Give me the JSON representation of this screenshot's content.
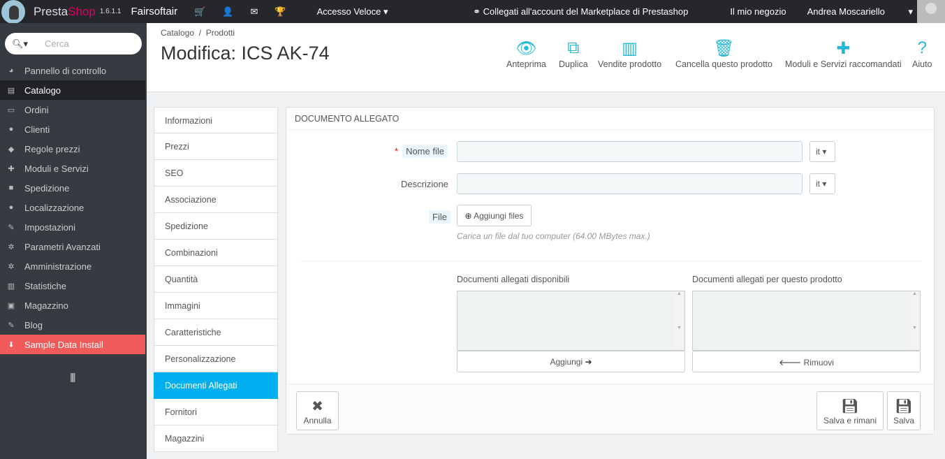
{
  "topbar": {
    "brand_a": "Presta",
    "brand_b": "Shop",
    "version": "1.6.1.1",
    "shop_name": "Fairsoftair",
    "quick_access": "Accesso Veloce",
    "marketplace": "Collegati all'account del Marketplace di Prestashop",
    "my_shop": "Il mio negozio",
    "user": "Andrea Moscariello"
  },
  "sidebar": {
    "search_placeholder": "Cerca",
    "items": [
      {
        "label": "Pannello di controllo",
        "icon": "dashboard-icon",
        "glyph": "◕"
      },
      {
        "label": "Catalogo",
        "icon": "book-icon",
        "glyph": "▤",
        "active": true
      },
      {
        "label": "Ordini",
        "icon": "credit-card-icon",
        "glyph": "▭"
      },
      {
        "label": "Clienti",
        "icon": "users-icon",
        "glyph": "●"
      },
      {
        "label": "Regole prezzi",
        "icon": "tags-icon",
        "glyph": "◆"
      },
      {
        "label": "Moduli e Servizi",
        "icon": "puzzle-icon",
        "glyph": "✚"
      },
      {
        "label": "Spedizione",
        "icon": "truck-icon",
        "glyph": "■"
      },
      {
        "label": "Localizzazione",
        "icon": "globe-icon",
        "glyph": "●"
      },
      {
        "label": "Impostazioni",
        "icon": "wrench-icon",
        "glyph": "✎"
      },
      {
        "label": "Parametri Avanzati",
        "icon": "cogs-icon",
        "glyph": "✲"
      },
      {
        "label": "Amministrazione",
        "icon": "cog-icon",
        "glyph": "✲"
      },
      {
        "label": "Statistiche",
        "icon": "bar-chart-icon",
        "glyph": "▥"
      },
      {
        "label": "Magazzino",
        "icon": "archive-icon",
        "glyph": "▣"
      },
      {
        "label": "Blog",
        "icon": "edit-icon",
        "glyph": "✎"
      },
      {
        "label": "Sample Data Install",
        "icon": "download-icon",
        "glyph": "⬇",
        "red": true
      }
    ]
  },
  "header": {
    "breadcrumb": [
      "Catalogo",
      "Prodotti"
    ],
    "title": "Modifica: ICS AK-74",
    "toolbar": [
      {
        "label": "Anteprima",
        "icon": "eye-icon",
        "glyph": "👁"
      },
      {
        "label": "Duplica",
        "icon": "copy-icon",
        "glyph": "⧉"
      },
      {
        "label": "Vendite prodotto",
        "icon": "bar-chart-icon",
        "glyph": "▥"
      },
      {
        "label": "Cancella questo prodotto",
        "icon": "trash-icon",
        "glyph": "🗑"
      },
      {
        "label": "Moduli e Servizi raccomandati",
        "icon": "puzzle-icon",
        "glyph": "✚"
      },
      {
        "label": "Aiuto",
        "icon": "question-icon",
        "glyph": "?"
      }
    ]
  },
  "tabs": [
    "Informazioni",
    "Prezzi",
    "SEO",
    "Associazione",
    "Spedizione",
    "Combinazioni",
    "Quantità",
    "Immagini",
    "Caratteristiche",
    "Personalizzazione",
    "Documenti Allegati",
    "Fornitori",
    "Magazzini"
  ],
  "active_tab": "Documenti Allegati",
  "panel": {
    "title": "DOCUMENTO ALLEGATO",
    "name_label": "Nome file",
    "name_value": "",
    "desc_label": "Descrizione",
    "desc_value": "",
    "lang": "it",
    "file_label": "File",
    "add_files": "Aggiungi files",
    "hint": "Carica un file dal tuo computer (64.00 MBytes max.)",
    "available_label": "Documenti allegati disponibili",
    "product_label": "Documenti allegati per questo prodotto",
    "add_btn": "Aggiungi",
    "remove_btn": "Rimuovi",
    "cancel": "Annulla",
    "save_stay": "Salva e rimani",
    "save": "Salva"
  }
}
